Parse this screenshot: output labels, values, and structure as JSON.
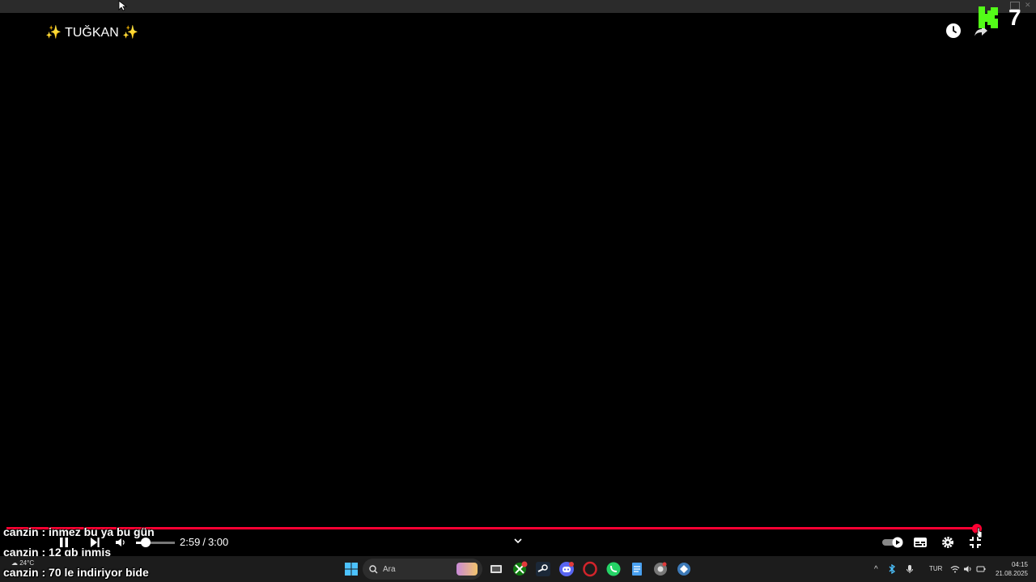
{
  "player": {
    "title": "✨ TUĞKAN ✨",
    "time_current": "2:59",
    "time_separator": "/",
    "time_total": "3:00",
    "progress_fraction": 0.994,
    "volume_fraction": 0.2,
    "accent_color": "#ff0033"
  },
  "overlay": {
    "kick_count": "7",
    "kick_color": "#53fc18"
  },
  "chat": {
    "messages": [
      {
        "user": "canzin",
        "text": "inmez bu ya bu gün"
      },
      {
        "user": "canzin",
        "text": "12 gb inmiş"
      },
      {
        "user": "canzin",
        "text": "70 le indiriyor bide"
      }
    ],
    "separator": " : "
  },
  "taskbar": {
    "weather_temp": "24°C",
    "search_placeholder": "Ara",
    "language": "TUR",
    "clock_time": "04:15",
    "clock_date": "21.08.2025"
  }
}
